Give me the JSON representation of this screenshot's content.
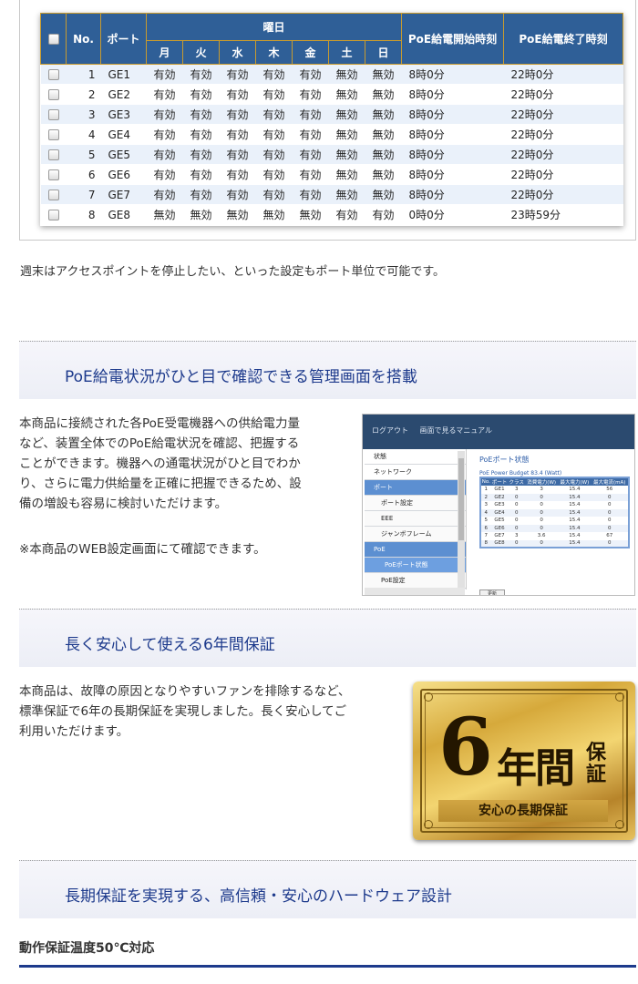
{
  "schedule": {
    "headers": {
      "no": "No.",
      "port": "ポート",
      "day_group": "曜日",
      "days": [
        "月",
        "火",
        "水",
        "木",
        "金",
        "土",
        "日"
      ],
      "start": "PoE給電開始時刻",
      "end": "PoE給電終了時刻"
    },
    "rows": [
      {
        "no": "1",
        "port": "GE1",
        "days": [
          "有効",
          "有効",
          "有効",
          "有効",
          "有効",
          "無効",
          "無効"
        ],
        "start": "8時0分",
        "end": "22時0分"
      },
      {
        "no": "2",
        "port": "GE2",
        "days": [
          "有効",
          "有効",
          "有効",
          "有効",
          "有効",
          "無効",
          "無効"
        ],
        "start": "8時0分",
        "end": "22時0分"
      },
      {
        "no": "3",
        "port": "GE3",
        "days": [
          "有効",
          "有効",
          "有効",
          "有効",
          "有効",
          "無効",
          "無効"
        ],
        "start": "8時0分",
        "end": "22時0分"
      },
      {
        "no": "4",
        "port": "GE4",
        "days": [
          "有効",
          "有効",
          "有効",
          "有効",
          "有効",
          "無効",
          "無効"
        ],
        "start": "8時0分",
        "end": "22時0分"
      },
      {
        "no": "5",
        "port": "GE5",
        "days": [
          "有効",
          "有効",
          "有効",
          "有効",
          "有効",
          "無効",
          "無効"
        ],
        "start": "8時0分",
        "end": "22時0分"
      },
      {
        "no": "6",
        "port": "GE6",
        "days": [
          "有効",
          "有効",
          "有効",
          "有効",
          "有効",
          "無効",
          "無効"
        ],
        "start": "8時0分",
        "end": "22時0分"
      },
      {
        "no": "7",
        "port": "GE7",
        "days": [
          "有効",
          "有効",
          "有効",
          "有効",
          "有効",
          "無効",
          "無効"
        ],
        "start": "8時0分",
        "end": "22時0分"
      },
      {
        "no": "8",
        "port": "GE8",
        "days": [
          "無効",
          "無効",
          "無効",
          "無効",
          "無効",
          "有効",
          "有効"
        ],
        "start": "0時0分",
        "end": "23時59分"
      }
    ]
  },
  "para1": "週末はアクセスポイントを停止したい、といった設定もポート単位で可能です。",
  "section1": {
    "title": "PoE給電状況がひと目で確認できる管理画面を搭載",
    "lines": [
      "本商品に接続された各PoE受電機器への供給電力量",
      "など、装置全体でのPoE給電状況を確認、把握する",
      "ことができます。機器への通電状況がひと目でわか",
      "り、さらに電力供給量を正確に把握できるため、設",
      "備の増設も容易に検討いただけます。"
    ],
    "note": "※本商品のWEB設定画面にて確認できます。"
  },
  "mini_screen": {
    "top_links": [
      "ログアウト",
      "画面で見るマニュアル"
    ],
    "menu": [
      {
        "label": "状態",
        "type": "it"
      },
      {
        "label": "ネットワーク",
        "type": "it"
      },
      {
        "label": "ポート",
        "type": "sel"
      },
      {
        "label": "ポート設定",
        "type": "sub"
      },
      {
        "label": "EEE",
        "type": "sub"
      },
      {
        "label": "ジャンボフレーム",
        "type": "sub"
      },
      {
        "label": "PoE",
        "type": "sel"
      },
      {
        "label": "PoEポート状態",
        "type": "sel2"
      },
      {
        "label": "PoE設定",
        "type": "sub"
      }
    ],
    "page_title": "PoEポート状態",
    "budget": "PoE Power Budget 83.4 (Watt)",
    "table_headers": [
      "No.",
      "ポート",
      "クラス",
      "消費電力(W)",
      "最大電力(W)",
      "最大電流(mA)"
    ],
    "table_rows": [
      [
        "1",
        "GE1",
        "3",
        "3",
        "15.4",
        "56"
      ],
      [
        "2",
        "GE2",
        "0",
        "0",
        "15.4",
        "0"
      ],
      [
        "3",
        "GE3",
        "0",
        "0",
        "15.4",
        "0"
      ],
      [
        "4",
        "GE4",
        "0",
        "0",
        "15.4",
        "0"
      ],
      [
        "5",
        "GE5",
        "0",
        "0",
        "15.4",
        "0"
      ],
      [
        "6",
        "GE6",
        "0",
        "0",
        "15.4",
        "0"
      ],
      [
        "7",
        "GE7",
        "3",
        "3.6",
        "15.4",
        "67"
      ],
      [
        "8",
        "GE8",
        "0",
        "0",
        "15.4",
        "0"
      ]
    ],
    "refresh_label": "更新"
  },
  "section2": {
    "title": "長く安心して使える6年間保証",
    "lines": [
      "本商品は、故障の原因となりやすいファンを排除するなど、",
      "標準保証で6年の長期保証を実現しました。長く安心してご",
      "利用いただけます。"
    ],
    "badge": {
      "digit": "6",
      "nen": "年間",
      "hosho": "保証",
      "sub": "安心の長期保証"
    }
  },
  "section3": {
    "title": "長期保証を実現する、高信頼・安心のハードウェア設計",
    "subhead": "動作保証温度50℃対応"
  }
}
